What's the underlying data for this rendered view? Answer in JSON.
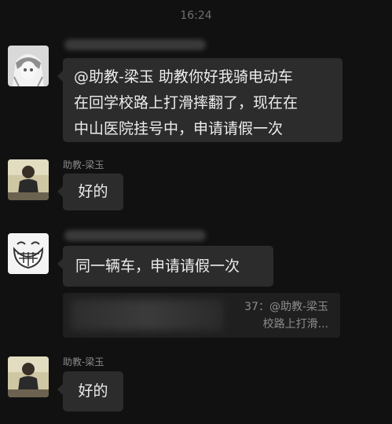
{
  "status_time": "16:24",
  "messages": [
    {
      "avatar_icon": "anime-girl-avatar-icon",
      "text": "@助教-梁玉 助教你好我骑电动车在回学校路上打滑摔翻了，现在在中山医院挂号中，申请请假一次",
      "lines": [
        "@助教-梁玉 助教你好我骑电动车",
        "在回学校路上打滑摔翻了，现在在",
        "中山医院挂号中，申请请假一次"
      ]
    },
    {
      "sender": "助教-梁玉",
      "avatar_icon": "photo-person-avatar-icon",
      "text": "好的"
    },
    {
      "avatar_icon": "grinning-face-avatar-icon",
      "text": "同一辆车，申请请假一次",
      "quote": {
        "line1": "37：@助教-梁玉",
        "line2": "校路上打滑..."
      }
    },
    {
      "sender": "助教-梁玉",
      "avatar_icon": "photo-person-avatar-icon",
      "text": "好的"
    }
  ]
}
